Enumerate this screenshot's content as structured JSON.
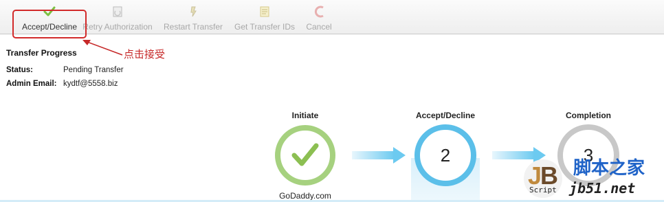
{
  "toolbar": {
    "accept_decline": "Accept/Decline",
    "retry_authorization": "Retry Authorization",
    "restart_transfer": "Restart Transfer",
    "get_transfer_ids": "Get Transfer IDs",
    "cancel": "Cancel"
  },
  "annotation": {
    "text": "点击接受",
    "color": "#c62828"
  },
  "transfer": {
    "title": "Transfer Progress",
    "status_label": "Status:",
    "status_value": "Pending Transfer",
    "admin_email_label": "Admin Email:",
    "admin_email_value": "kydtf@5558.biz"
  },
  "steps": [
    {
      "title": "Initiate",
      "state": "complete",
      "sub": "GoDaddy.com",
      "color": "#a6d17f"
    },
    {
      "title": "Accept/Decline",
      "state": "current",
      "number": "2",
      "color": "#5bbfe9"
    },
    {
      "title": "Completion",
      "state": "pending",
      "number": "3",
      "color": "#c8c8c8"
    }
  ],
  "watermark": {
    "script": "Script",
    "brand": "脚本之家",
    "url": "jb51.net"
  }
}
